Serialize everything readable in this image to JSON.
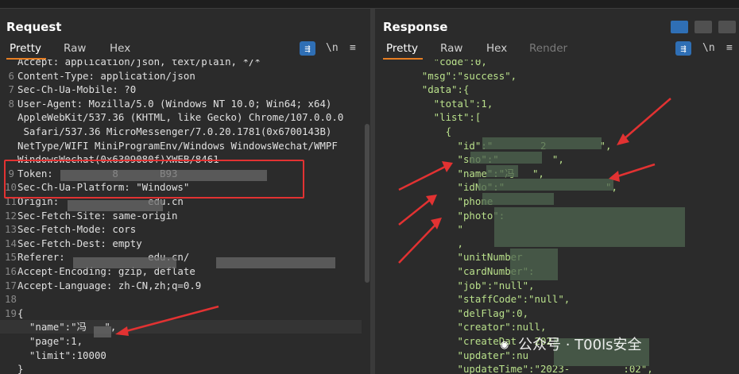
{
  "request": {
    "title": "Request",
    "tabs": [
      "Pretty",
      "Raw",
      "Hex"
    ],
    "wrap_icon": "wrap-lines-icon",
    "newline_label": "\\n",
    "menu_icon": "hamburger-icon",
    "lines": [
      {
        "n": "",
        "t": "Accept: application/json, text/plain, */*"
      },
      {
        "n": "6",
        "t": "Content-Type: application/json"
      },
      {
        "n": "7",
        "t": "Sec-Ch-Ua-Mobile: ?0"
      },
      {
        "n": "8",
        "t": "User-Agent: Mozilla/5.0 (Windows NT 10.0; Win64; x64)"
      },
      {
        "n": "",
        "t": "AppleWebKit/537.36 (KHTML, like Gecko) Chrome/107.0.0.0"
      },
      {
        "n": "",
        "t": " Safari/537.36 MicroMessenger/7.0.20.1781(0x6700143B)"
      },
      {
        "n": "",
        "t": "NetType/WIFI MiniProgramEnv/Windows WindowsWechat/WMPF"
      },
      {
        "n": "",
        "t": "WindowsWechat(0x6309080f)XWEB/8461"
      },
      {
        "n": "9",
        "t": "Token:          8       B93"
      },
      {
        "n": "10",
        "t": "Sec-Ch-Ua-Platform: \"Windows\""
      },
      {
        "n": "11",
        "t": "Origin:               edu.cn"
      },
      {
        "n": "12",
        "t": "Sec-Fetch-Site: same-origin"
      },
      {
        "n": "13",
        "t": "Sec-Fetch-Mode: cors"
      },
      {
        "n": "14",
        "t": "Sec-Fetch-Dest: empty"
      },
      {
        "n": "15",
        "t": "Referer:              edu.cn/"
      },
      {
        "n": "16",
        "t": "Accept-Encoding: gzip, deflate"
      },
      {
        "n": "17",
        "t": "Accept-Language: zh-CN,zh;q=0.9"
      },
      {
        "n": "18",
        "t": ""
      },
      {
        "n": "19",
        "t": "{"
      },
      {
        "n": "",
        "t": "  \"name\":\"冯   \","
      },
      {
        "n": "",
        "t": "  \"page\":1,"
      },
      {
        "n": "",
        "t": "  \"limit\":10000"
      },
      {
        "n": "",
        "t": "}"
      }
    ]
  },
  "response": {
    "title": "Response",
    "tabs": [
      "Pretty",
      "Raw",
      "Hex",
      "Render"
    ],
    "wrap_icon": "wrap-lines-icon",
    "newline_label": "\\n",
    "menu_icon": "hamburger-icon",
    "lines": [
      "        \"code\":0,",
      "      \"msg\":\"success\",",
      "      \"data\":{",
      "        \"total\":1,",
      "        \"list\":[",
      "          {",
      "            \"id\":\"        2         \",",
      "            \"sno\":\"         \",",
      "            \"name\":\"冯   \",",
      "            \"idNo\":\"                 \",",
      "            \"phone",
      "            \"photo\":",
      "            \"",
      "            ,",
      "            \"unitNumber",
      "            \"cardNumber\":",
      "            \"job\":\"null\",",
      "            \"staffCode\":\"null\",",
      "            \"delFlag\":0,",
      "            \"creator\":null,",
      "            \"createDat   2023",
      "            \"updater\":nu",
      "            \"updateTime\":\"2023-         :02\","
    ]
  },
  "layout_buttons": [
    "split-horizontal-icon",
    "split-vertical-icon",
    "single-pane-icon"
  ],
  "watermark": "公众号 · T00ls安全",
  "colors": {
    "accent": "#e67e22",
    "highlight_box": "#e23232",
    "key": "#7ec4ff",
    "string": "#c6e38f",
    "button": "#2f6fb5"
  }
}
